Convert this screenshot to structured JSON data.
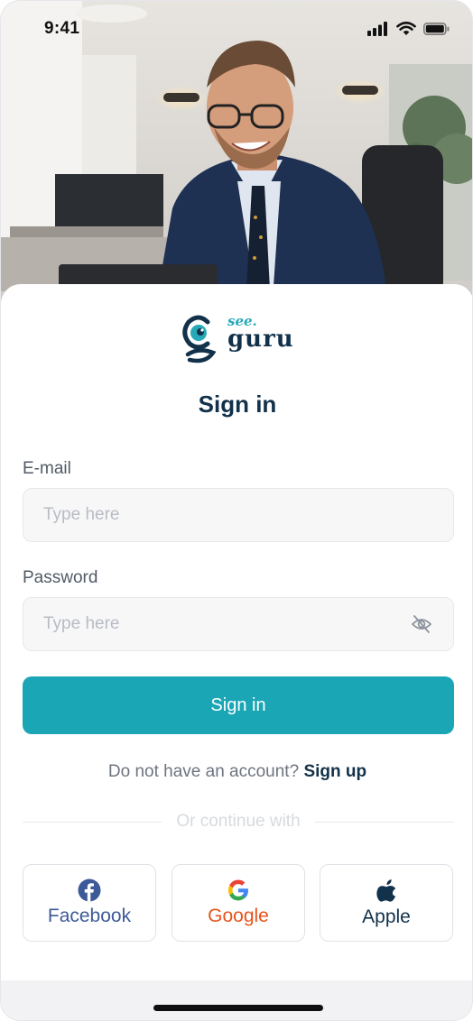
{
  "status_bar": {
    "time": "9:41"
  },
  "logo": {
    "see": "see.",
    "guru": "guru"
  },
  "title": "Sign in",
  "email": {
    "label": "E-mail",
    "placeholder": "Type here"
  },
  "password": {
    "label": "Password",
    "placeholder": "Type here"
  },
  "signin_button": "Sign in",
  "account": {
    "prompt": "Do not have an account?",
    "link": "Sign up"
  },
  "divider_text": "Or continue with",
  "social": [
    {
      "label": "Facebook",
      "icon": "facebook-icon"
    },
    {
      "label": "Google",
      "icon": "google-icon"
    },
    {
      "label": "Apple",
      "icon": "apple-icon"
    }
  ],
  "colors": {
    "primary": "#1ba6b5",
    "navy": "#12314a",
    "facebook": "#3d5a98",
    "google": "#e8531b"
  }
}
